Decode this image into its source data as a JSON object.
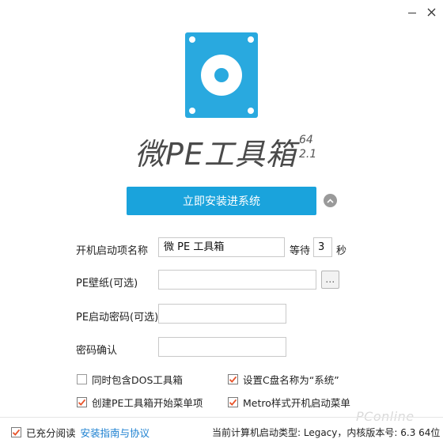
{
  "window": {
    "minimize_icon": "minimize-icon",
    "close_icon": "close-icon"
  },
  "brand": {
    "title": "微PE工具箱",
    "arch": "64",
    "version": "2.1",
    "logo_icon": "disc-drive-icon",
    "logo_color": "#29a9df"
  },
  "actions": {
    "install_label": "立即安装进系统",
    "collapse_icon": "chevron-up-icon",
    "accent": "#1aa3dc"
  },
  "form": {
    "boot_name_label": "开机启动项名称",
    "boot_name_value": "微 PE 工具箱",
    "wait_label": "等待",
    "wait_value": "3",
    "seconds_label": "秒",
    "wallpaper_label": "PE壁纸(可选)",
    "wallpaper_value": "",
    "browse_label": "...",
    "password_label": "PE启动密码(可选)",
    "password_value": "",
    "confirm_label": "密码确认",
    "confirm_value": ""
  },
  "options": [
    {
      "label": "同时包含DOS工具箱",
      "checked": false
    },
    {
      "label": "设置C盘名称为“系统”",
      "checked": true
    },
    {
      "label": "创建PE工具箱开始菜单项",
      "checked": true
    },
    {
      "label": "Metro样式开机启动菜单",
      "checked": true
    }
  ],
  "footer": {
    "agree_label": "已充分阅读",
    "agree_link": "安装指南与协议",
    "agree_checked": true,
    "status": "当前计算机启动类型: Legacy，内核版本号: 6.3 64位",
    "watermark": "PConline"
  }
}
